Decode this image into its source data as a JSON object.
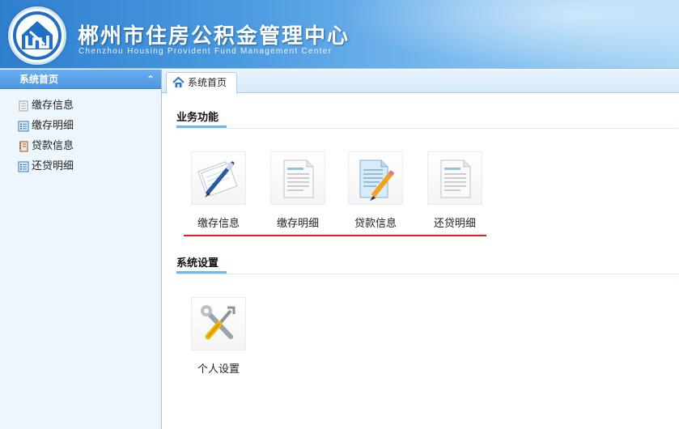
{
  "header": {
    "title": "郴州市住房公积金管理中心",
    "subtitle": "Chenzhou Housing Provident Fund Management Center"
  },
  "sidebar": {
    "title": "系统首页",
    "items": [
      {
        "label": "缴存信息",
        "icon": "document-icon"
      },
      {
        "label": "缴存明细",
        "icon": "list-icon"
      },
      {
        "label": "贷款信息",
        "icon": "notebook-icon"
      },
      {
        "label": "还贷明细",
        "icon": "list-icon"
      }
    ]
  },
  "tabs": [
    {
      "label": "系统首页",
      "icon": "home-icon",
      "active": true
    }
  ],
  "sections": [
    {
      "title": "业务功能",
      "tiles": [
        {
          "label": "缴存信息",
          "icon": "pen-paper-icon"
        },
        {
          "label": "缴存明细",
          "icon": "document-icon"
        },
        {
          "label": "贷款信息",
          "icon": "pencil-document-icon"
        },
        {
          "label": "还贷明细",
          "icon": "document-icon"
        }
      ]
    },
    {
      "title": "系统设置",
      "tiles": [
        {
          "label": "个人设置",
          "icon": "tools-icon"
        }
      ]
    }
  ],
  "colors": {
    "header_start": "#2f7fcf",
    "header_end": "#a9d6f6",
    "sidebar_head": "#4d96e2",
    "section_accent": "#6cb8e6",
    "annotation_red": "#e02020"
  }
}
